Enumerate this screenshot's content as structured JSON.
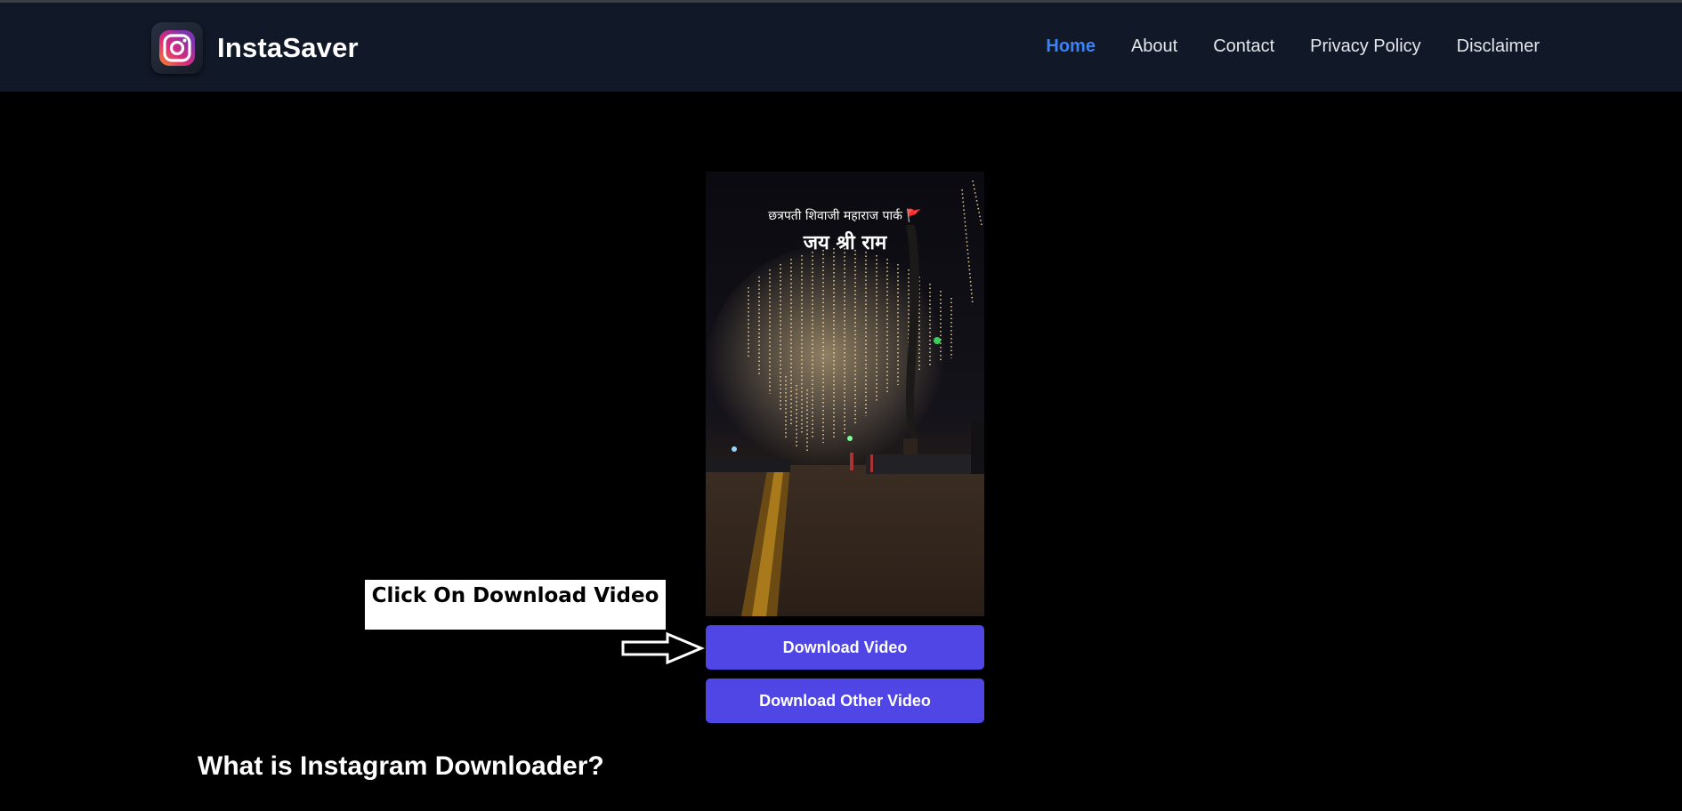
{
  "header": {
    "brand": "InstaSaver",
    "nav": [
      {
        "label": "Home",
        "active": true
      },
      {
        "label": "About",
        "active": false
      },
      {
        "label": "Contact",
        "active": false
      },
      {
        "label": "Privacy Policy",
        "active": false
      },
      {
        "label": "Disclaimer",
        "active": false
      }
    ]
  },
  "video": {
    "caption_line1": "छत्रपती शिवाजी महाराज पार्क 🚩",
    "caption_line2": "जय श्री राम"
  },
  "buttons": {
    "download": "Download Video",
    "download_other": "Download Other Video"
  },
  "annotation": {
    "text": "Click On Download Video"
  },
  "section": {
    "title": "What is Instagram Downloader?"
  },
  "colors": {
    "header_bg": "#111827",
    "accent": "#3b82f6",
    "button": "#4f46e5",
    "page_bg": "#000000"
  },
  "icons": {
    "logo": "instagram-icon",
    "pointer": "right-arrow-icon"
  }
}
